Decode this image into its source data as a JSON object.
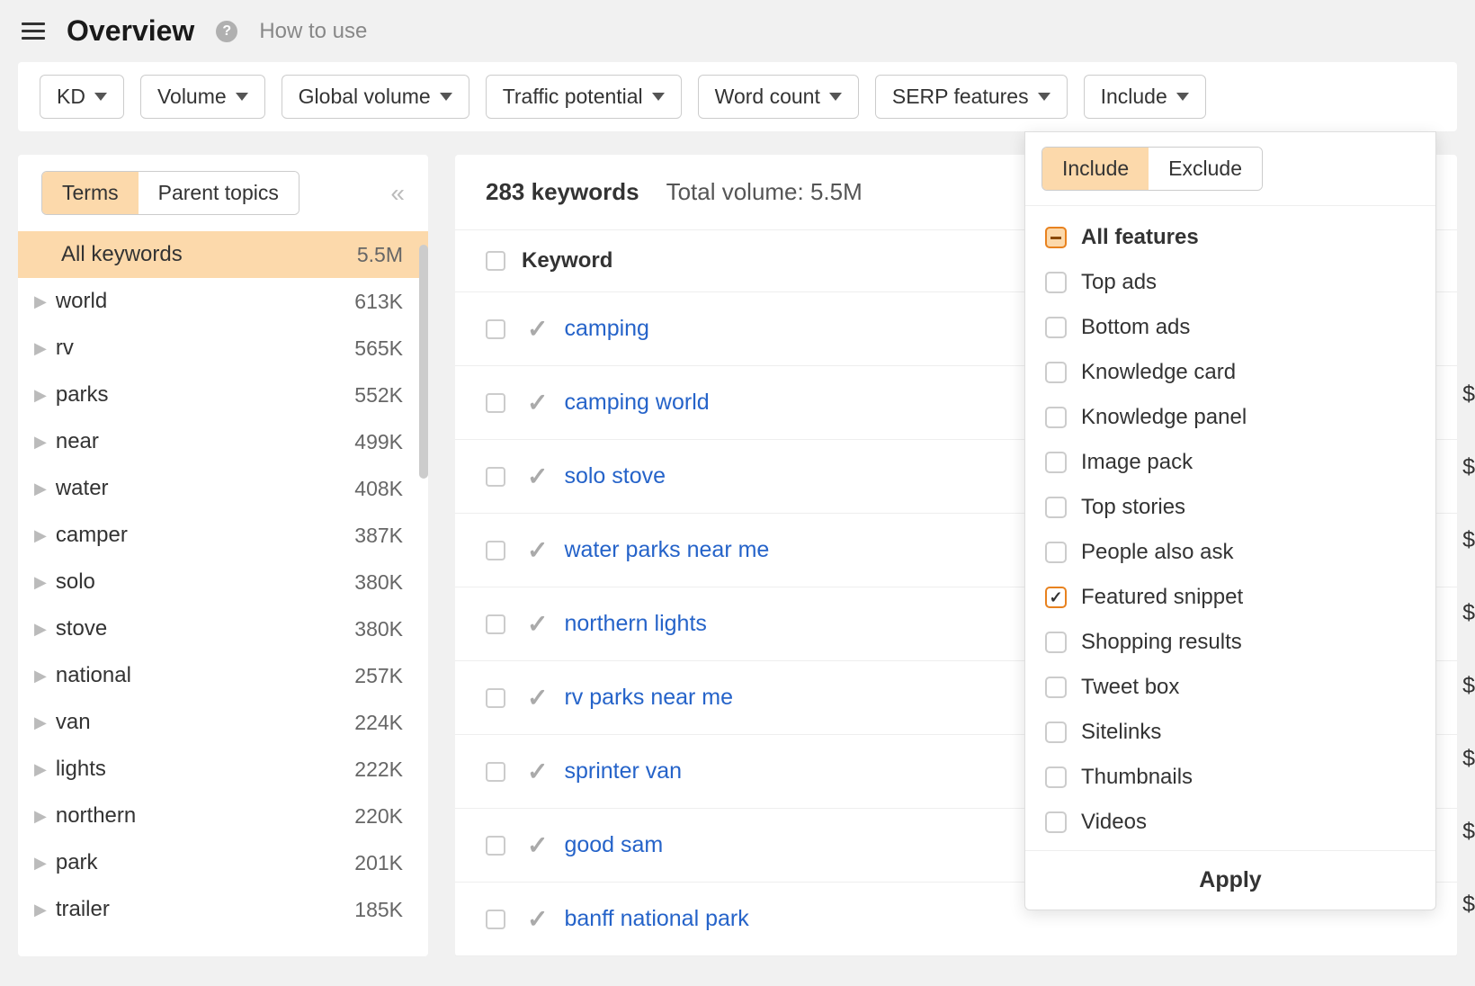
{
  "header": {
    "title": "Overview",
    "help_label": "How to use"
  },
  "filters": {
    "kd": "KD",
    "volume": "Volume",
    "global_volume": "Global volume",
    "traffic_potential": "Traffic potential",
    "word_count": "Word count",
    "serp_features": "SERP features",
    "include": "Include"
  },
  "sidebar": {
    "tabs": {
      "terms": "Terms",
      "parent_topics": "Parent topics"
    },
    "all_keywords": {
      "label": "All keywords",
      "count": "5.5M"
    },
    "terms": [
      {
        "label": "world",
        "count": "613K"
      },
      {
        "label": "rv",
        "count": "565K"
      },
      {
        "label": "parks",
        "count": "552K"
      },
      {
        "label": "near",
        "count": "499K"
      },
      {
        "label": "water",
        "count": "408K"
      },
      {
        "label": "camper",
        "count": "387K"
      },
      {
        "label": "solo",
        "count": "380K"
      },
      {
        "label": "stove",
        "count": "380K"
      },
      {
        "label": "national",
        "count": "257K"
      },
      {
        "label": "van",
        "count": "224K"
      },
      {
        "label": "lights",
        "count": "222K"
      },
      {
        "label": "northern",
        "count": "220K"
      },
      {
        "label": "park",
        "count": "201K"
      },
      {
        "label": "trailer",
        "count": "185K"
      }
    ]
  },
  "content": {
    "keyword_count": "283 keywords",
    "total_volume": "Total volume: 5.5M",
    "column_keyword": "Keyword",
    "keywords": [
      "camping",
      "camping world",
      "solo stove",
      "water parks near me",
      "northern lights",
      "rv parks near me",
      "sprinter van",
      "good sam",
      "banff national park"
    ]
  },
  "serp_panel": {
    "include_tab": "Include",
    "exclude_tab": "Exclude",
    "all_features": "All features",
    "features": [
      {
        "label": "Top ads",
        "checked": false
      },
      {
        "label": "Bottom ads",
        "checked": false
      },
      {
        "label": "Knowledge card",
        "checked": false
      },
      {
        "label": "Knowledge panel",
        "checked": false
      },
      {
        "label": "Image pack",
        "checked": false
      },
      {
        "label": "Top stories",
        "checked": false
      },
      {
        "label": "People also ask",
        "checked": false
      },
      {
        "label": "Featured snippet",
        "checked": true
      },
      {
        "label": "Shopping results",
        "checked": false
      },
      {
        "label": "Tweet box",
        "checked": false
      },
      {
        "label": "Sitelinks",
        "checked": false
      },
      {
        "label": "Thumbnails",
        "checked": false
      },
      {
        "label": "Videos",
        "checked": false
      }
    ],
    "apply": "Apply"
  },
  "dollar": "$"
}
